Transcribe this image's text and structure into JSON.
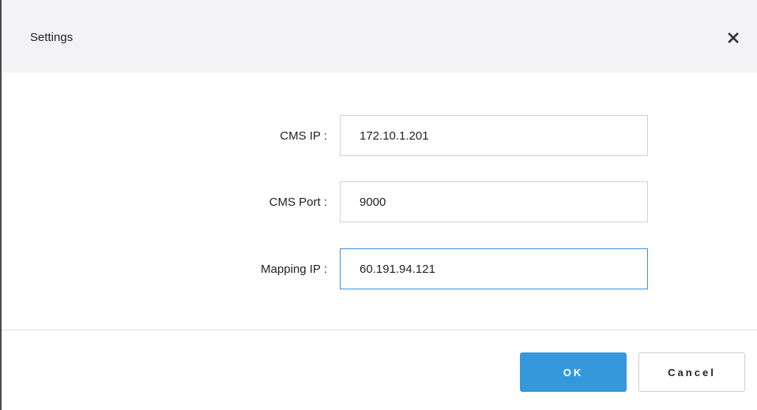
{
  "dialog": {
    "title": "Settings",
    "close_icon": "close-icon"
  },
  "form": {
    "cms_ip": {
      "label": "CMS IP :",
      "value": "172.10.1.201"
    },
    "cms_port": {
      "label": "CMS Port :",
      "value": "9000"
    },
    "mapping_ip": {
      "label": "Mapping IP :",
      "value": "60.191.94.121"
    }
  },
  "footer": {
    "ok_label": "OK",
    "cancel_label": "Cancel"
  },
  "colors": {
    "primary": "#3598dc",
    "focus_border": "#3a8ee6",
    "header_bg": "#f3f2f5"
  }
}
